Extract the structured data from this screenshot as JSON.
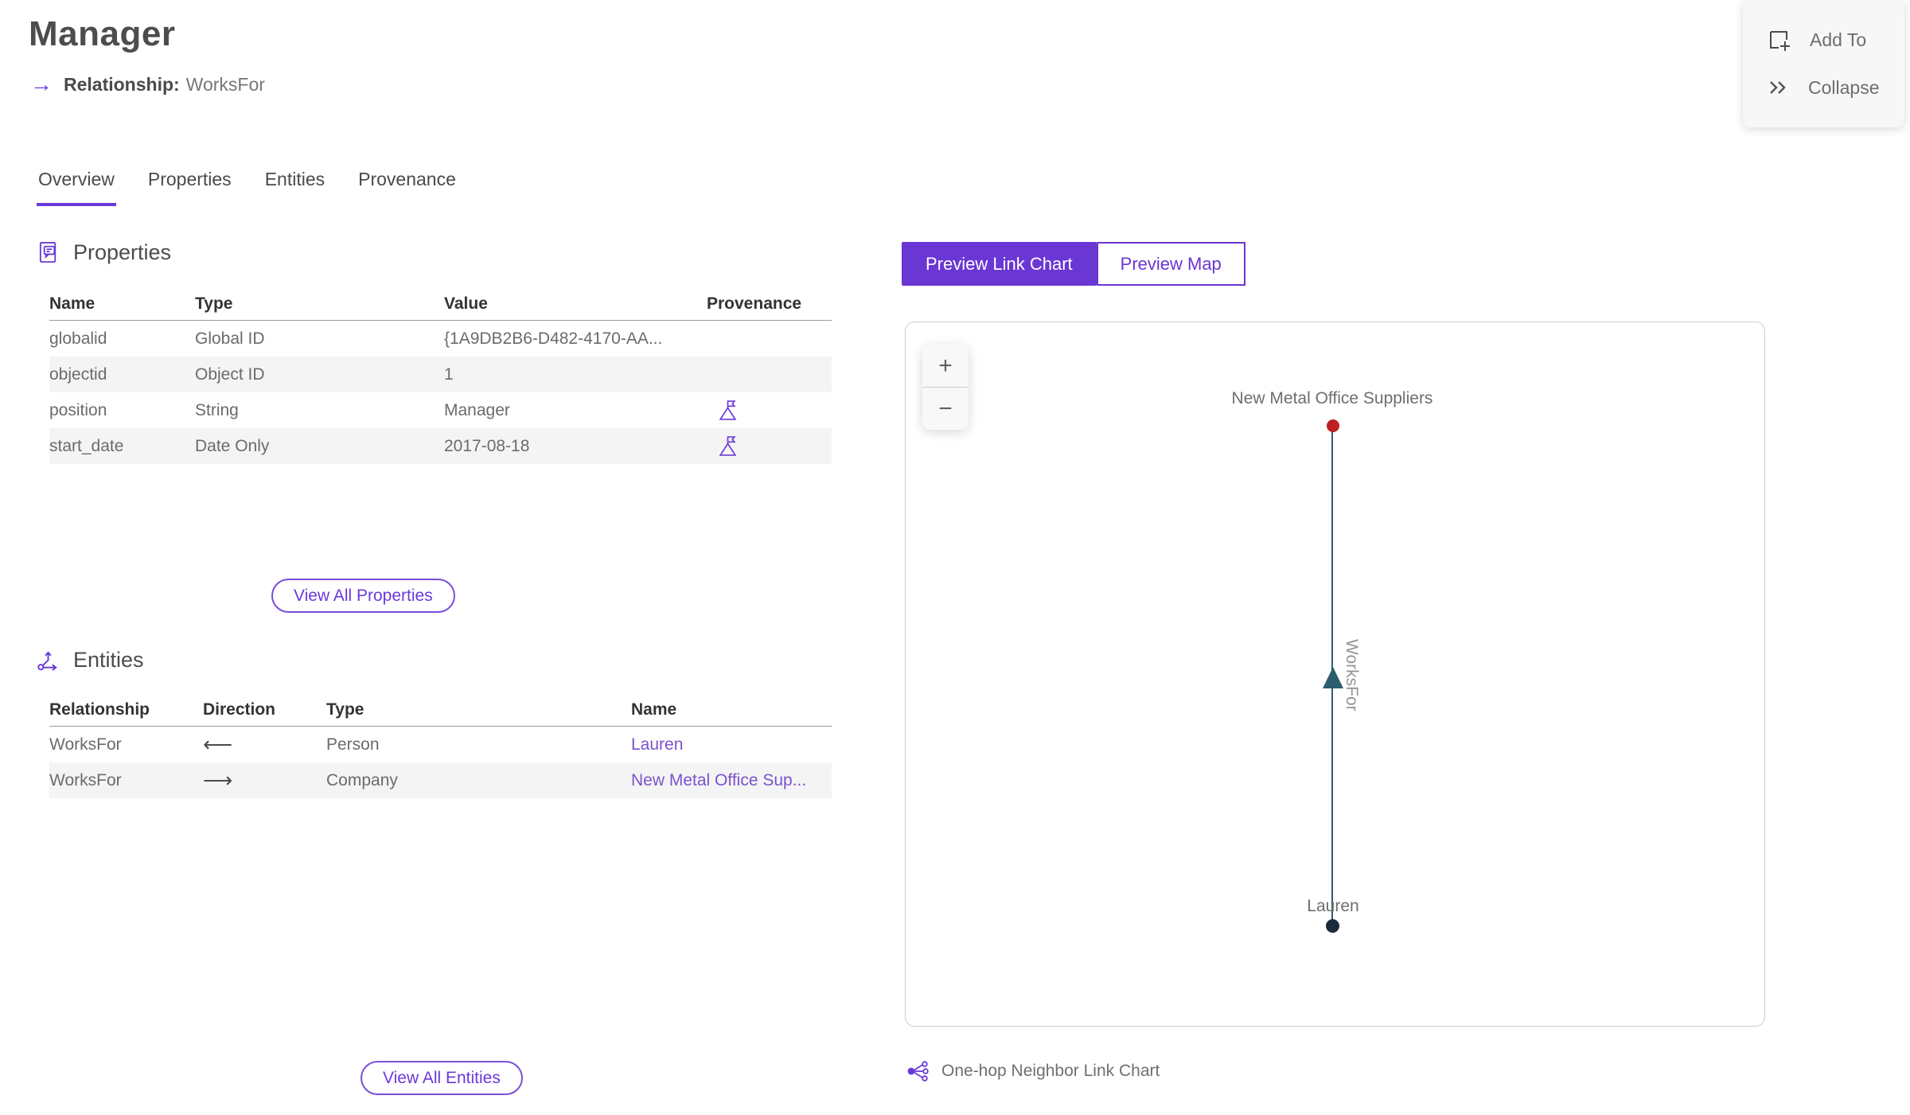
{
  "header": {
    "title": "Manager",
    "subtitle_label": "Relationship:",
    "subtitle_value": "WorksFor",
    "arrow_glyph": "→"
  },
  "actions": {
    "add_to_label": "Add To",
    "collapse_label": "Collapse"
  },
  "tabs": [
    {
      "label": "Overview",
      "active": true
    },
    {
      "label": "Properties",
      "active": false
    },
    {
      "label": "Entities",
      "active": false
    },
    {
      "label": "Provenance",
      "active": false
    }
  ],
  "properties_section": {
    "heading": "Properties",
    "columns": [
      "Name",
      "Type",
      "Value",
      "Provenance"
    ],
    "rows": [
      {
        "name": "globalid",
        "type": "Global ID",
        "value": "{1A9DB2B6-D482-4170-AA...",
        "provenance": false
      },
      {
        "name": "objectid",
        "type": "Object ID",
        "value": "1",
        "provenance": false
      },
      {
        "name": "position",
        "type": "String",
        "value": "Manager",
        "provenance": true
      },
      {
        "name": "start_date",
        "type": "Date Only",
        "value": "2017-08-18",
        "provenance": true
      }
    ],
    "view_all_label": "View All Properties"
  },
  "entities_section": {
    "heading": "Entities",
    "columns": [
      "Relationship",
      "Direction",
      "Type",
      "Name"
    ],
    "rows": [
      {
        "relationship": "WorksFor",
        "direction": "⟵",
        "type": "Person",
        "name": "Lauren"
      },
      {
        "relationship": "WorksFor",
        "direction": "⟶",
        "type": "Company",
        "name": "New Metal Office Sup..."
      }
    ],
    "view_all_label": "View All Entities"
  },
  "preview": {
    "toggle": [
      {
        "label": "Preview Link Chart",
        "active": true
      },
      {
        "label": "Preview Map",
        "active": false
      }
    ],
    "zoom_in_glyph": "+",
    "zoom_out_glyph": "−",
    "caption": "One-hop Neighbor Link Chart"
  },
  "chart_data": {
    "type": "node-link",
    "nodes": [
      {
        "label": "New Metal Office Suppliers",
        "color": "#bf1f24",
        "position": "top"
      },
      {
        "label": "Lauren",
        "color": "#1c2b3c",
        "position": "bottom"
      }
    ],
    "edges": [
      {
        "label": "WorksFor",
        "from": "Lauren",
        "to": "New Metal Office Suppliers",
        "color": "#2c5d6d",
        "direction": "up"
      }
    ]
  },
  "colors": {
    "accent_purple": "#6a36d4",
    "link_purple": "#7a52cc",
    "edge_teal": "#2c5d6d",
    "node_red": "#bf1f24",
    "node_navy": "#1c2b3c"
  }
}
